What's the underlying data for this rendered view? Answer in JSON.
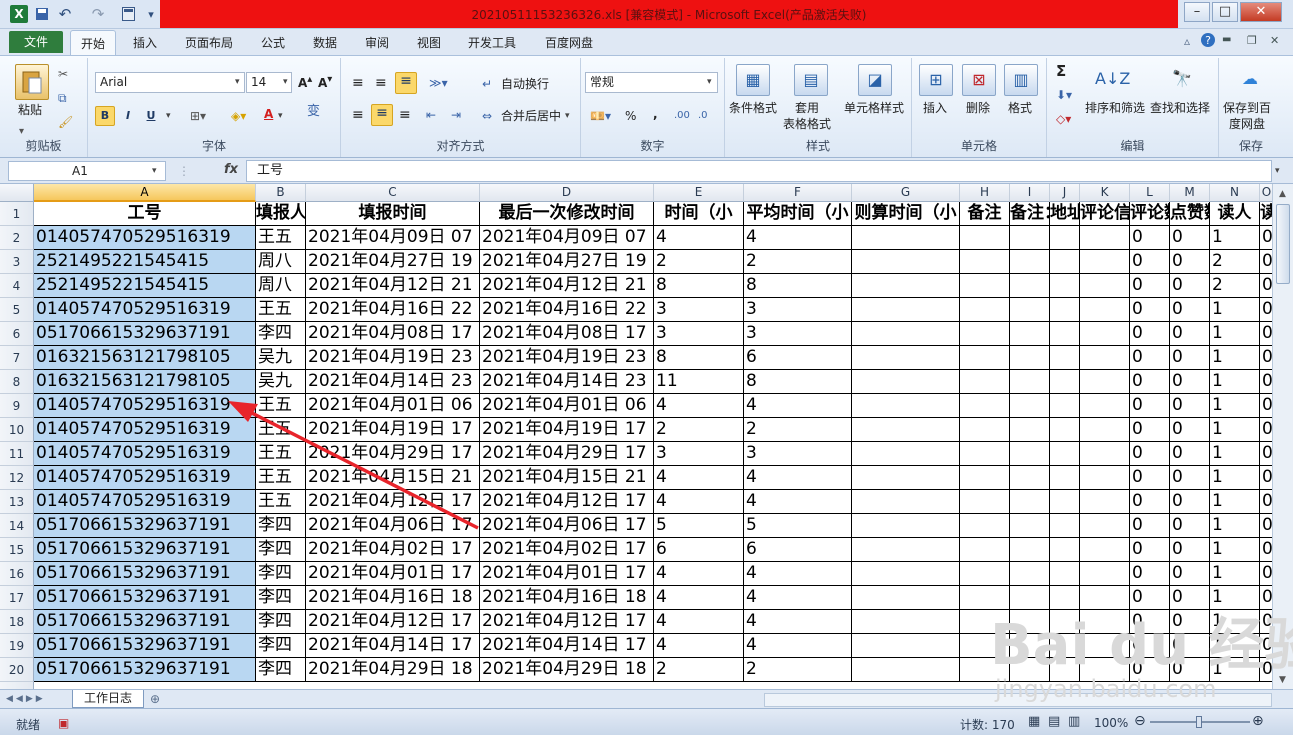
{
  "title": {
    "text": "20210511153236326.xls  [兼容模式]  -  Microsoft Excel(产品激活失败)"
  },
  "qat": {
    "logo": "X",
    "undo": "↶",
    "redo": "↷"
  },
  "window_controls": {
    "minimize": "–",
    "restore": "□",
    "close": "✕"
  },
  "tabs": {
    "file": "文件",
    "items": [
      "开始",
      "插入",
      "页面布局",
      "公式",
      "数据",
      "审阅",
      "视图",
      "开发工具",
      "百度网盘"
    ]
  },
  "ribbon": {
    "clipboard": {
      "paste": "粘贴",
      "label": "剪贴板"
    },
    "font": {
      "name": "Arial",
      "size": "14",
      "bold": "B",
      "italic": "I",
      "underline": "U",
      "label": "字体"
    },
    "alignment": {
      "wrap": "自动换行",
      "merge": "合并后居中",
      "label": "对齐方式"
    },
    "number": {
      "format": "常规",
      "percent": "%",
      "comma": ",",
      "label": "数字"
    },
    "styles": {
      "conditional": "条件格式",
      "table": "套用\n表格格式",
      "cell": "单元格样式",
      "label": "样式"
    },
    "cells": {
      "insert": "插入",
      "delete": "删除",
      "format": "格式",
      "label": "单元格"
    },
    "editing": {
      "sigma": "Σ",
      "sort": "排序和筛选",
      "find": "查找和选择",
      "label": "编辑"
    },
    "save": {
      "cloud": "保存到百\n度网盘",
      "label": "保存"
    }
  },
  "formula_bar": {
    "name_box": "A1",
    "fx": "fx",
    "content": "工号"
  },
  "columns": [
    "A",
    "B",
    "C",
    "D",
    "E",
    "F",
    "G",
    "H",
    "I",
    "J",
    "K",
    "L",
    "M",
    "N",
    "O"
  ],
  "header_row": [
    "工号",
    "填报人",
    "填报时间",
    "最后一次修改时间",
    "时间（小",
    "平均时间（小",
    "则算时间（小",
    "备注",
    "备注：",
    "地址",
    "评论信",
    "评论数",
    "点赞数",
    "读人",
    "读"
  ],
  "rows": [
    [
      "014057470529516319",
      "王五",
      "2021年04月09日 07",
      "2021年04月09日 07",
      "4",
      "4",
      "",
      "",
      "",
      "",
      "",
      "0",
      "0",
      "1",
      "0"
    ],
    [
      "2521495221545415",
      "周八",
      "2021年04月27日 19",
      "2021年04月27日 19",
      "2",
      "2",
      "",
      "",
      "",
      "",
      "",
      "0",
      "0",
      "2",
      "0"
    ],
    [
      "2521495221545415",
      "周八",
      "2021年04月12日 21",
      "2021年04月12日 21",
      "8",
      "8",
      "",
      "",
      "",
      "",
      "",
      "0",
      "0",
      "2",
      "0"
    ],
    [
      "014057470529516319",
      "王五",
      "2021年04月16日 22",
      "2021年04月16日 22",
      "3",
      "3",
      "",
      "",
      "",
      "",
      "",
      "0",
      "0",
      "1",
      "0"
    ],
    [
      "051706615329637191",
      "李四",
      "2021年04月08日 17",
      "2021年04月08日 17",
      "3",
      "3",
      "",
      "",
      "",
      "",
      "",
      "0",
      "0",
      "1",
      "0"
    ],
    [
      "016321563121798105",
      "吴九",
      "2021年04月19日 23",
      "2021年04月19日 23",
      "8",
      "6",
      "",
      "",
      "",
      "",
      "",
      "0",
      "0",
      "1",
      "0"
    ],
    [
      "016321563121798105",
      "吴九",
      "2021年04月14日 23",
      "2021年04月14日 23",
      "11",
      "8",
      "",
      "",
      "",
      "",
      "",
      "0",
      "0",
      "1",
      "0"
    ],
    [
      "014057470529516319",
      "王五",
      "2021年04月01日 06",
      "2021年04月01日 06",
      "4",
      "4",
      "",
      "",
      "",
      "",
      "",
      "0",
      "0",
      "1",
      "0"
    ],
    [
      "014057470529516319",
      "王五",
      "2021年04月19日 17",
      "2021年04月19日 17",
      "2",
      "2",
      "",
      "",
      "",
      "",
      "",
      "0",
      "0",
      "1",
      "0"
    ],
    [
      "014057470529516319",
      "王五",
      "2021年04月29日 17",
      "2021年04月29日 17",
      "3",
      "3",
      "",
      "",
      "",
      "",
      "",
      "0",
      "0",
      "1",
      "0"
    ],
    [
      "014057470529516319",
      "王五",
      "2021年04月15日 21",
      "2021年04月15日 21",
      "4",
      "4",
      "",
      "",
      "",
      "",
      "",
      "0",
      "0",
      "1",
      "0"
    ],
    [
      "014057470529516319",
      "王五",
      "2021年04月12日 17",
      "2021年04月12日 17",
      "4",
      "4",
      "",
      "",
      "",
      "",
      "",
      "0",
      "0",
      "1",
      "0"
    ],
    [
      "051706615329637191",
      "李四",
      "2021年04月06日 17",
      "2021年04月06日 17",
      "5",
      "5",
      "",
      "",
      "",
      "",
      "",
      "0",
      "0",
      "1",
      "0"
    ],
    [
      "051706615329637191",
      "李四",
      "2021年04月02日 17",
      "2021年04月02日 17",
      "6",
      "6",
      "",
      "",
      "",
      "",
      "",
      "0",
      "0",
      "1",
      "0"
    ],
    [
      "051706615329637191",
      "李四",
      "2021年04月01日 17",
      "2021年04月01日 17",
      "4",
      "4",
      "",
      "",
      "",
      "",
      "",
      "0",
      "0",
      "1",
      "0"
    ],
    [
      "051706615329637191",
      "李四",
      "2021年04月16日 18",
      "2021年04月16日 18",
      "4",
      "4",
      "",
      "",
      "",
      "",
      "",
      "0",
      "0",
      "1",
      "0"
    ],
    [
      "051706615329637191",
      "李四",
      "2021年04月12日 17",
      "2021年04月12日 17",
      "4",
      "4",
      "",
      "",
      "",
      "",
      "",
      "0",
      "0",
      "1",
      "0"
    ],
    [
      "051706615329637191",
      "李四",
      "2021年04月14日 17",
      "2021年04月14日 17",
      "4",
      "4",
      "",
      "",
      "",
      "",
      "",
      "0",
      "0",
      "1",
      "0"
    ],
    [
      "051706615329637191",
      "李四",
      "2021年04月29日 18",
      "2021年04月29日 18",
      "2",
      "2",
      "",
      "",
      "",
      "",
      "",
      "0",
      "0",
      "1",
      "0"
    ]
  ],
  "sheet_tab": "工作日志",
  "status": {
    "ready": "就绪",
    "count": "计数: 170",
    "zoom": "100%"
  },
  "watermark": {
    "brand": "Bai du 经验",
    "url": "jingyan.baidu.com"
  }
}
